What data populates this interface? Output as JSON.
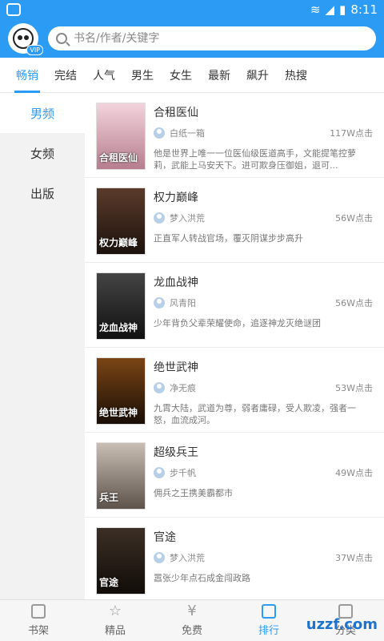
{
  "status_bar": {
    "time": "8:11"
  },
  "header": {
    "search_placeholder": "书名/作者/关键字",
    "vip_badge": "VIP"
  },
  "tabs": [
    {
      "label": "畅销",
      "active": true
    },
    {
      "label": "完结"
    },
    {
      "label": "人气"
    },
    {
      "label": "男生"
    },
    {
      "label": "女生"
    },
    {
      "label": "最新"
    },
    {
      "label": "飙升"
    },
    {
      "label": "热搜"
    }
  ],
  "sidebar": [
    {
      "label": "男频",
      "active": true
    },
    {
      "label": "女频"
    },
    {
      "label": "出版"
    }
  ],
  "books": [
    {
      "title": "合租医仙",
      "author": "白纸一箱",
      "clicks": "117W点击",
      "desc": "他是世界上唯一一位医仙级医道高手，文能提笔控萝莉，武能上马安天下。进可欺身压御姐，退可...",
      "cover_text": "合租医仙",
      "cover_color": "#d8a7b6"
    },
    {
      "title": "权力巅峰",
      "author": "梦入洪荒",
      "clicks": "56W点击",
      "desc": "正直军人转战官场，覆灭阴谋步步高升",
      "cover_text": "权力巅峰",
      "cover_color": "#3a2a22"
    },
    {
      "title": "龙血战神",
      "author": "风青阳",
      "clicks": "56W点击",
      "desc": "少年背负父辈荣耀使命，追逐神龙灭绝谜团",
      "cover_text": "龙血战神",
      "cover_color": "#2b2b2b"
    },
    {
      "title": "绝世武神",
      "author": "净无痕",
      "clicks": "53W点击",
      "desc": "九霄大陆，武道为尊，弱者庸碌，受人欺凌，强者一怒，血流成河。",
      "cover_text": "绝世武神",
      "cover_color": "#4a2a0f"
    },
    {
      "title": "超级兵王",
      "author": "步千帆",
      "clicks": "49W点击",
      "desc": "佣兵之王携美霸都市",
      "cover_text": "兵王",
      "cover_color": "#6b6159"
    },
    {
      "title": "官途",
      "author": "梦入洪荒",
      "clicks": "37W点击",
      "desc": "嚣张少年点石成金闯政路",
      "cover_text": "官途",
      "cover_color": "#231c17"
    }
  ],
  "bottom_nav": [
    {
      "label": "书架",
      "icon": "bookshelf-icon"
    },
    {
      "label": "精品",
      "icon": "star-icon"
    },
    {
      "label": "免费",
      "icon": "yen-icon"
    },
    {
      "label": "排行",
      "icon": "rank-icon",
      "active": true
    },
    {
      "label": "分类",
      "icon": "category-icon"
    }
  ],
  "watermark": "uzzf.com"
}
